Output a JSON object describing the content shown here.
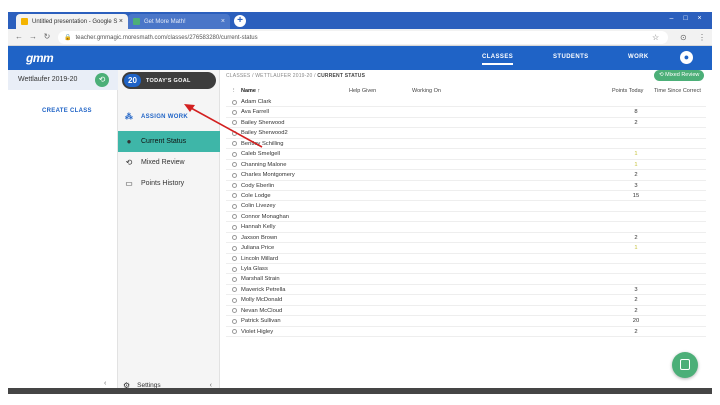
{
  "browser": {
    "tabs": [
      {
        "label": "Untitled presentation - Google S",
        "favicon_color": "#f4b400"
      },
      {
        "label": "Get More Math!",
        "favicon_color": "#4caf78"
      }
    ],
    "url": "teacher.gmmagic.moresmath.com/classes/276583280/current-status"
  },
  "app": {
    "logo": "gmm",
    "nav": [
      {
        "label": "CLASSES",
        "active": true
      },
      {
        "label": "STUDENTS",
        "active": false
      },
      {
        "label": "WORK",
        "active": false
      }
    ]
  },
  "class_sidebar": {
    "current_class": "Wettlaufer 2019-20",
    "create_label": "CREATE CLASS"
  },
  "menu": {
    "goal_count": "20",
    "goal_label": "TODAY'S GOAL",
    "assign_work": "ASSIGN WORK",
    "items": [
      {
        "label": "Current Status",
        "selected": true
      },
      {
        "label": "Mixed Review",
        "selected": false
      },
      {
        "label": "Points History",
        "selected": false
      }
    ],
    "settings": "Settings"
  },
  "main": {
    "breadcrumb": [
      "CLASSES",
      "WETTLAUFER 2019-20",
      "CURRENT STATUS"
    ],
    "mixed_review_button": "Mixed Review",
    "columns": {
      "name": "Name ↑",
      "help": "Help Given",
      "working_on": "Working On",
      "points": "Points Today",
      "time": "Time Since Correct"
    },
    "students": [
      {
        "name": "Adam Clark",
        "points": ""
      },
      {
        "name": "Ava Farrell",
        "points": "8"
      },
      {
        "name": "Bailey Sherwood",
        "points": "2"
      },
      {
        "name": "Bailey Sherwood2",
        "points": ""
      },
      {
        "name": "Bentley Schilling",
        "points": ""
      },
      {
        "name": "Caleb Smelgell",
        "points": "1"
      },
      {
        "name": "Channing Malone",
        "points": "1"
      },
      {
        "name": "Charles Montgomery",
        "points": "2"
      },
      {
        "name": "Cody Eberlin",
        "points": "3"
      },
      {
        "name": "Cole Lodge",
        "points": "15"
      },
      {
        "name": "Colin Livezey",
        "points": ""
      },
      {
        "name": "Connor Monaghan",
        "points": ""
      },
      {
        "name": "Hannah Kelly",
        "points": ""
      },
      {
        "name": "Jaxson Brown",
        "points": "2"
      },
      {
        "name": "Juliana Price",
        "points": "1"
      },
      {
        "name": "Lincoln Millard",
        "points": ""
      },
      {
        "name": "Lyla Glass",
        "points": ""
      },
      {
        "name": "Marshall Strain",
        "points": ""
      },
      {
        "name": "Maverick Petrella",
        "points": "3"
      },
      {
        "name": "Molly McDonald",
        "points": "2"
      },
      {
        "name": "Nevan McCloud",
        "points": "2"
      },
      {
        "name": "Patrick Sullivan",
        "points": "20"
      },
      {
        "name": "Violet Higley",
        "points": "2"
      }
    ]
  },
  "colors": {
    "brand_blue": "#1f63c6",
    "selected_teal": "#3eb6a8",
    "accent_green": "#4caf78",
    "annotation_red": "#d32020"
  }
}
